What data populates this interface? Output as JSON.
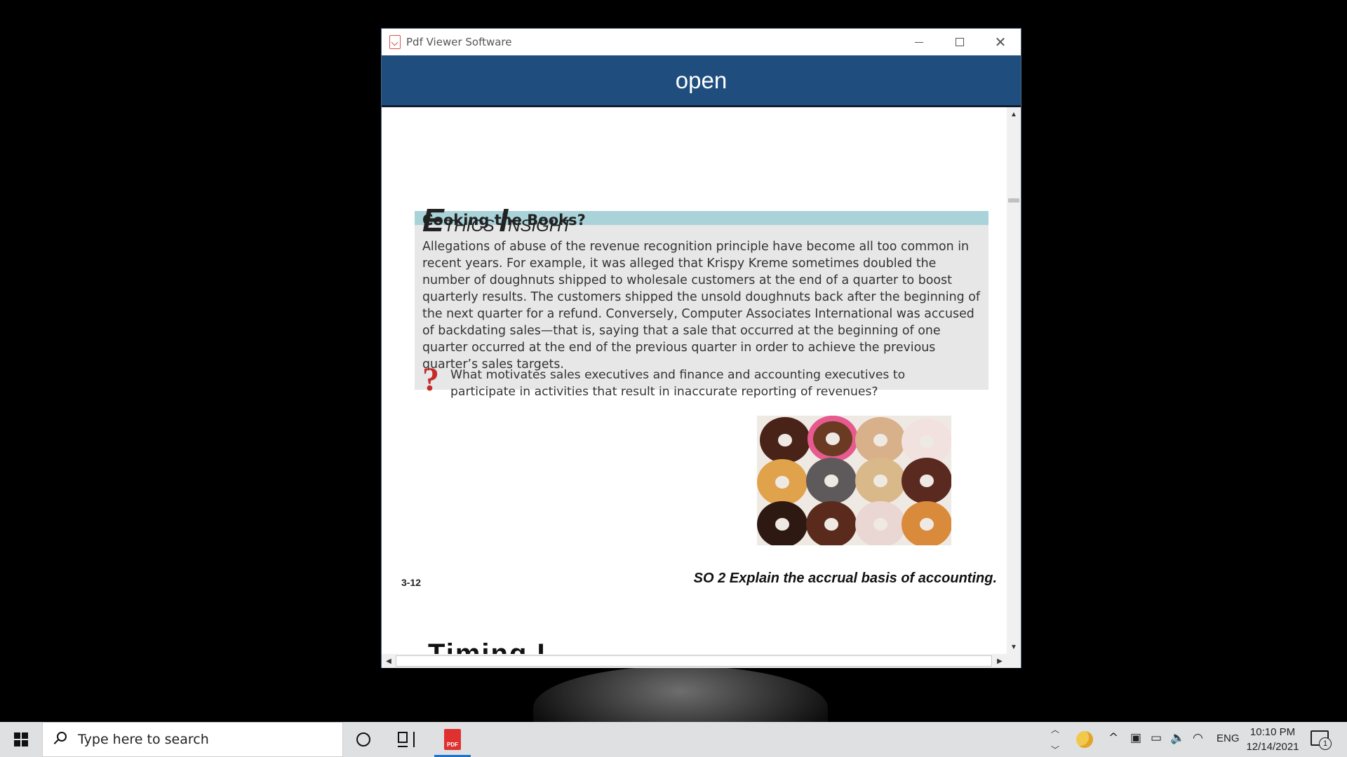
{
  "window": {
    "title": "Pdf Viewer Software",
    "open_label": "open"
  },
  "page": {
    "ethics_letter_e": "E",
    "ethics_rest_1": "THICS ",
    "ethics_letter_i": "I",
    "ethics_rest_2": "NSIGHT",
    "heading": "Cooking the Books?",
    "body": "Allegations of abuse of the revenue recognition principle have become all too common in recent years. For example, it was alleged that Krispy Kreme sometimes doubled the number of doughnuts shipped to wholesale customers at the end of a quarter to boost quarterly results. The customers shipped the unsold doughnuts back after the beginning of the next quarter for a refund. Conversely, Computer Associates International was accused of backdating sales—that is, saying that a sale that occurred at the beginning of one quarter occurred at the end of the previous quarter in order to achieve the previous quarter’s sales targets.",
    "question_mark": "?",
    "question": "What motivates sales executives and finance and accounting executives to participate in activities that result in inaccurate reporting of revenues?",
    "page_number": "3-12",
    "study_objective": "SO 2  Explain the accrual basis of accounting.",
    "next_heading_partial": "Timing I"
  },
  "taskbar": {
    "search_placeholder": "Type here to search",
    "pdf_icon_text": "PDF",
    "language": "ENG",
    "time": "10:10 PM",
    "date": "12/14/2021",
    "notification_count": "1"
  },
  "colors": {
    "header_bar": "#1f4e7e",
    "ethics_stripe": "#a9d3d9",
    "ethics_box": "#e7e7e7",
    "question_mark": "#c62b2b",
    "pdf_icon": "#e03131",
    "active_underline": "#1a73c8"
  },
  "icons": {
    "app": "pdf-file-icon",
    "minimize": "minimize-icon",
    "maximize": "maximize-icon",
    "close": "close-icon",
    "start": "windows-logo-icon",
    "search": "search-icon",
    "cortana": "cortana-circle-icon",
    "task_view": "task-view-icon",
    "weather": "moon-weather-icon",
    "notifications": "action-center-icon"
  }
}
